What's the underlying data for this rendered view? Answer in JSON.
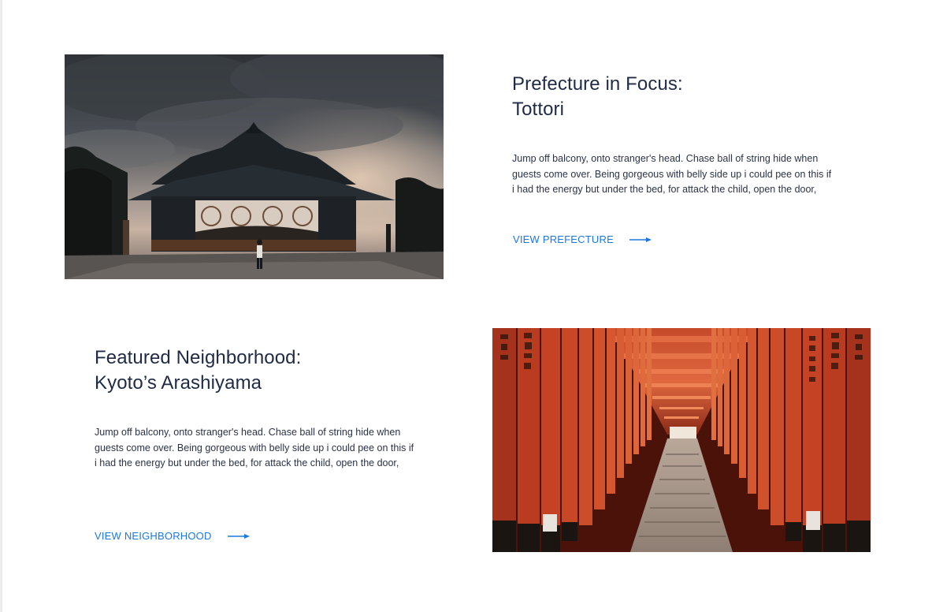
{
  "features": [
    {
      "title_line1": "Prefecture in Focus:",
      "title_line2": "Tottori",
      "body_lines": [
        "Jump off balcony, onto stranger's head. Chase ball of string hide when",
        "guests come over. Being gorgeous with belly side up i could pee on this if",
        "i had the energy but under the bed, for attack the child, open the door,"
      ],
      "link_label": "VIEW PREFECTURE",
      "link_icon": "arrow-right-icon",
      "image": "temple-under-stormy-sky"
    },
    {
      "title_line1": "Featured Neighborhood:",
      "title_line2": "Kyoto’s Arashiyama",
      "body_lines": [
        "Jump off balcony, onto stranger's head. Chase ball of string hide when",
        "guests come over. Being gorgeous with belly side up i could pee on this if",
        "i had the energy but under the bed, for attack the child, open the door,"
      ],
      "link_label": "VIEW NEIGHBORHOOD",
      "link_icon": "arrow-right-icon",
      "image": "torii-gate-tunnel-stairs"
    }
  ],
  "colors": {
    "heading": "#1f2b45",
    "body": "#2a3346",
    "link": "#1c78dd",
    "background": "#ffffff"
  }
}
